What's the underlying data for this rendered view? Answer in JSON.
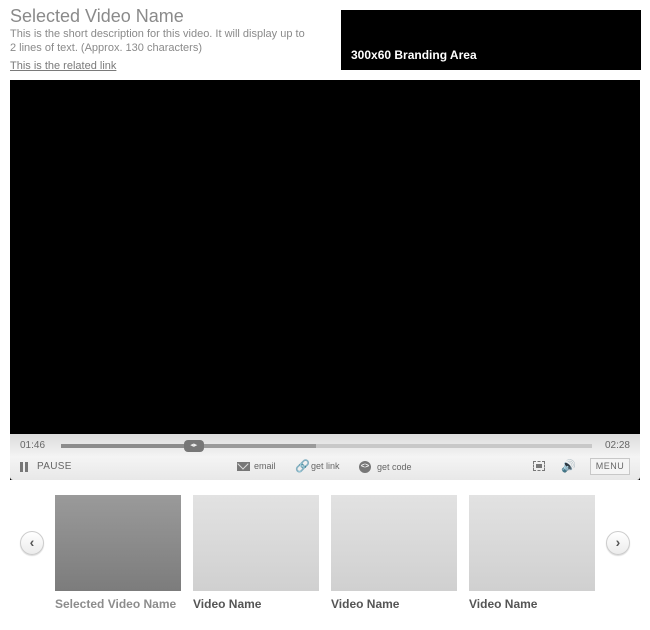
{
  "header": {
    "title": "Selected Video Name",
    "description": "This is the short description for this video. It will display up to 2 lines of text. (Approx. 130 characters)",
    "related_link": "This is the related link"
  },
  "branding": {
    "label": "300x60 Branding Area"
  },
  "player": {
    "current_time": "01:46",
    "total_time": "02:28",
    "progress_fraction": 0.25,
    "buffered_fraction": 0.48,
    "thumb_glyph": "◂▸",
    "pause_label": "PAUSE",
    "actions": [
      {
        "label": "email",
        "icon": "email-icon"
      },
      {
        "label": "get link",
        "icon": "link-icon"
      },
      {
        "label": "get code",
        "icon": "code-icon"
      }
    ],
    "link_glyph": "🔗",
    "code_glyph": "<>",
    "volume_glyph": "🔊",
    "menu_label": "MENU"
  },
  "carousel": {
    "prev_glyph": "‹",
    "next_glyph": "›",
    "items": [
      {
        "title": "Selected Video Name",
        "selected": true
      },
      {
        "title": "Video Name",
        "selected": false
      },
      {
        "title": "Video Name",
        "selected": false
      },
      {
        "title": "Video Name",
        "selected": false
      }
    ]
  }
}
